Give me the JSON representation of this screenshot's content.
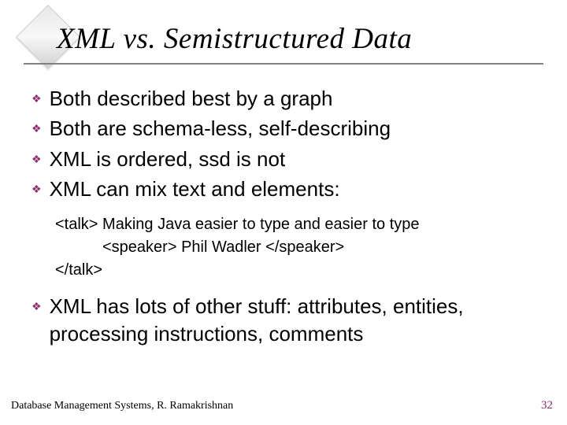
{
  "title": "XML vs. Semistructured Data",
  "bullets1": {
    "b0": "Both described best by a graph",
    "b1": "Both are schema-less, self-describing",
    "b2": "XML is ordered, ssd is not",
    "b3": "XML can mix text and elements:"
  },
  "code": {
    "line1": "<talk> Making Java easier to type and easier to type",
    "line2": "<speaker> Phil Wadler </speaker>",
    "line3": "</talk>"
  },
  "bullets2": {
    "b0": "XML has lots of other stuff: attributes, entities, processing instructions, comments"
  },
  "footer": {
    "left": "Database Management Systems, R. Ramakrishnan",
    "right": "32"
  }
}
